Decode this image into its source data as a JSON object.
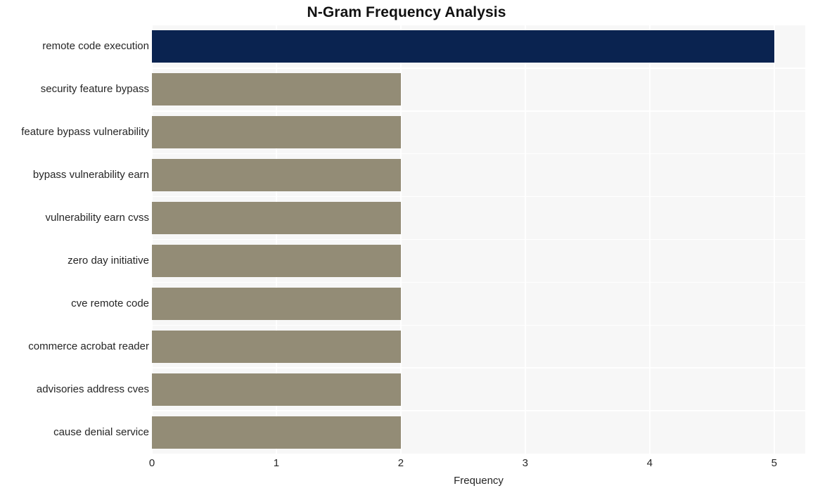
{
  "chart_data": {
    "type": "bar",
    "orientation": "horizontal",
    "title": "N-Gram Frequency Analysis",
    "xlabel": "Frequency",
    "ylabel": "",
    "categories": [
      "remote code execution",
      "security feature bypass",
      "feature bypass vulnerability",
      "bypass vulnerability earn",
      "vulnerability earn cvss",
      "zero day initiative",
      "cve remote code",
      "commerce acrobat reader",
      "advisories address cves",
      "cause denial service"
    ],
    "values": [
      5,
      2,
      2,
      2,
      2,
      2,
      2,
      2,
      2,
      2
    ],
    "xlim": [
      0,
      5.25
    ],
    "xticks": [
      "0",
      "1",
      "2",
      "3",
      "4",
      "5"
    ],
    "xtick_values": [
      0,
      1,
      2,
      3,
      4,
      5
    ],
    "grid": true,
    "legend": "none",
    "bar_colors": [
      "#0a2350",
      "#938c76",
      "#938c76",
      "#938c76",
      "#938c76",
      "#938c76",
      "#938c76",
      "#938c76",
      "#938c76",
      "#938c76"
    ],
    "highlight_color": "#0a2350",
    "default_bar_color": "#938c76",
    "plot_background": "#f7f7f7",
    "grid_color": "#ffffff",
    "figure_background": "#ffffff",
    "text_color": "#262626",
    "title_color": "#111111"
  }
}
